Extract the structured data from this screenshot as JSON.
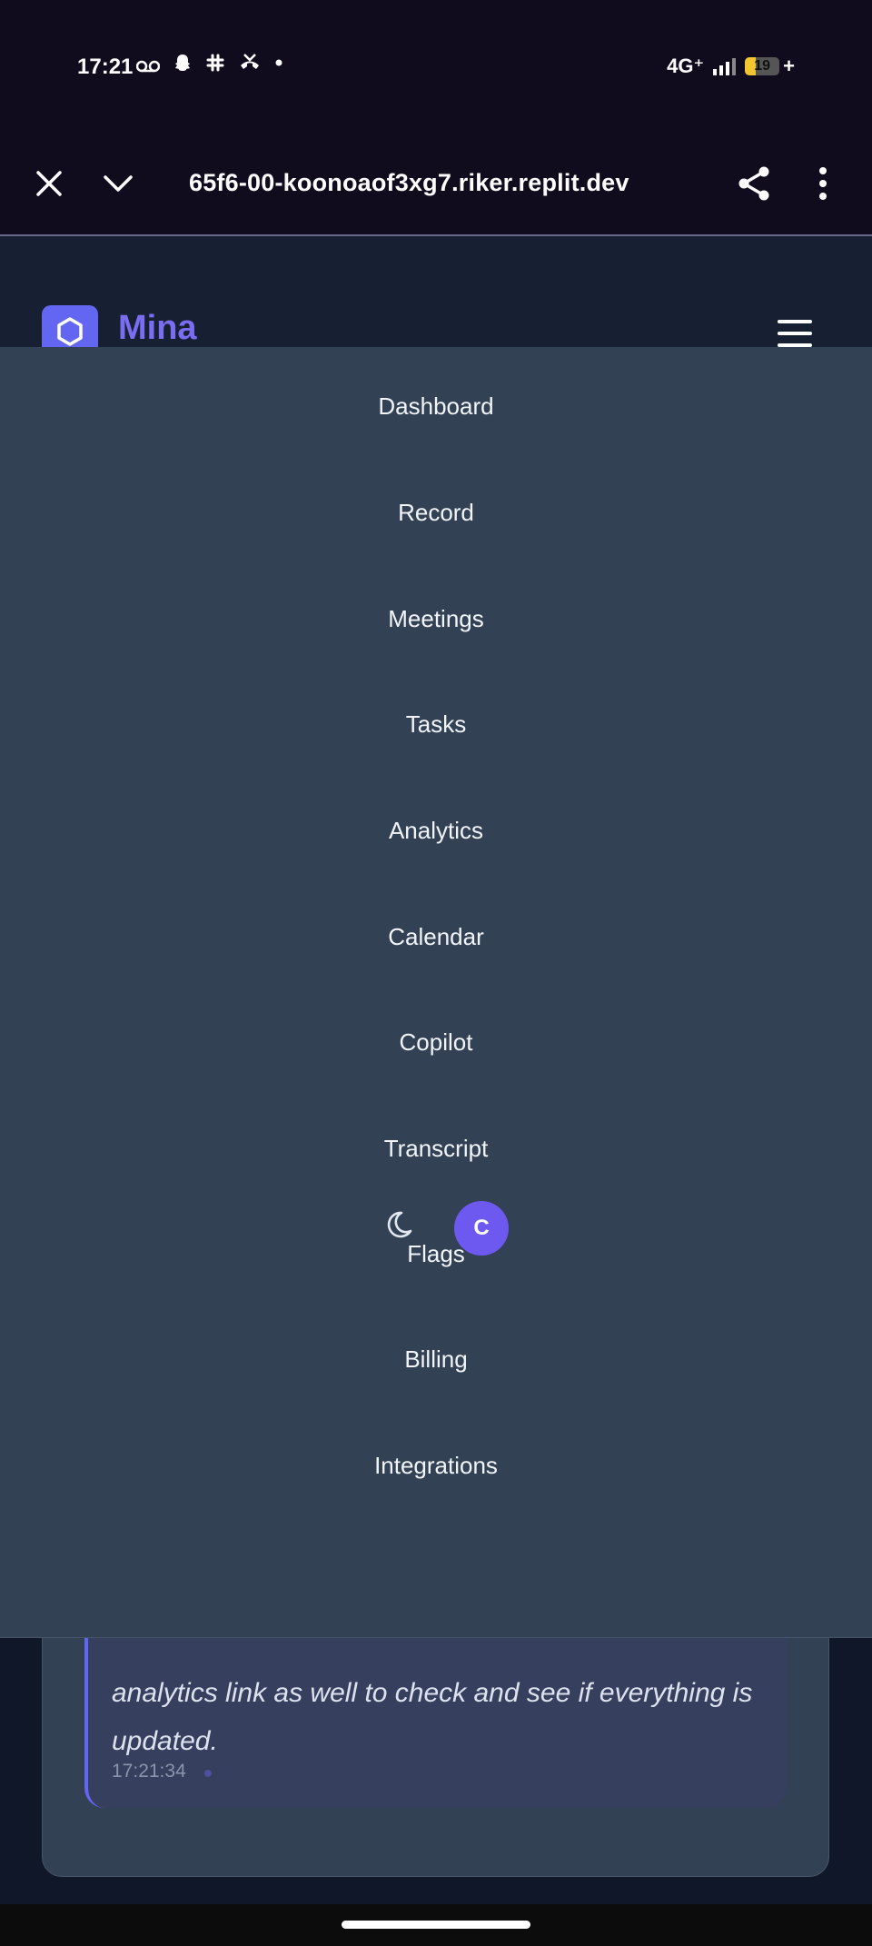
{
  "status_bar": {
    "time": "17:21",
    "icons": [
      "voicemail-icon",
      "snapchat-icon",
      "slack-icon",
      "missed-call-icon",
      "dot-icon"
    ],
    "network": "4G⁺",
    "battery": "19",
    "battery_charging": "+"
  },
  "browser": {
    "url": "65f6-00-koonoaof3xg7.riker.replit.dev"
  },
  "header": {
    "brand": "Mina"
  },
  "menu": {
    "items": [
      {
        "label": "Dashboard"
      },
      {
        "label": "Record"
      },
      {
        "label": "Meetings"
      },
      {
        "label": "Tasks"
      },
      {
        "label": "Analytics"
      },
      {
        "label": "Calendar"
      },
      {
        "label": "Copilot"
      },
      {
        "label": "Transcript"
      },
      {
        "label": "Flags"
      },
      {
        "label": "Billing"
      },
      {
        "label": "Integrations"
      }
    ],
    "avatar_initial": "C"
  },
  "transcript": {
    "text": "analytics link as well to check and see if everything is updated.",
    "time": "17:21:34"
  },
  "colors": {
    "accent": "#6366f1",
    "brand": "#7b6df2",
    "menu_bg": "#334155"
  }
}
